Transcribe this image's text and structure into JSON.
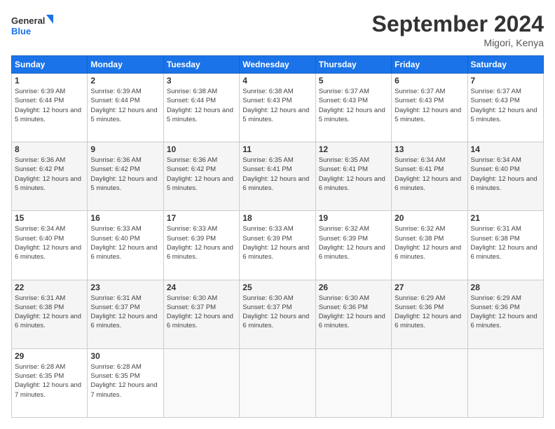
{
  "logo": {
    "line1": "General",
    "line2": "Blue"
  },
  "title": "September 2024",
  "location": "Migori, Kenya",
  "days_header": [
    "Sunday",
    "Monday",
    "Tuesday",
    "Wednesday",
    "Thursday",
    "Friday",
    "Saturday"
  ],
  "weeks": [
    [
      {
        "day": "1",
        "sunrise": "6:39 AM",
        "sunset": "6:44 PM",
        "daylight": "12 hours and 5 minutes."
      },
      {
        "day": "2",
        "sunrise": "6:39 AM",
        "sunset": "6:44 PM",
        "daylight": "12 hours and 5 minutes."
      },
      {
        "day": "3",
        "sunrise": "6:38 AM",
        "sunset": "6:44 PM",
        "daylight": "12 hours and 5 minutes."
      },
      {
        "day": "4",
        "sunrise": "6:38 AM",
        "sunset": "6:43 PM",
        "daylight": "12 hours and 5 minutes."
      },
      {
        "day": "5",
        "sunrise": "6:37 AM",
        "sunset": "6:43 PM",
        "daylight": "12 hours and 5 minutes."
      },
      {
        "day": "6",
        "sunrise": "6:37 AM",
        "sunset": "6:43 PM",
        "daylight": "12 hours and 5 minutes."
      },
      {
        "day": "7",
        "sunrise": "6:37 AM",
        "sunset": "6:43 PM",
        "daylight": "12 hours and 5 minutes."
      }
    ],
    [
      {
        "day": "8",
        "sunrise": "6:36 AM",
        "sunset": "6:42 PM",
        "daylight": "12 hours and 5 minutes."
      },
      {
        "day": "9",
        "sunrise": "6:36 AM",
        "sunset": "6:42 PM",
        "daylight": "12 hours and 5 minutes."
      },
      {
        "day": "10",
        "sunrise": "6:36 AM",
        "sunset": "6:42 PM",
        "daylight": "12 hours and 5 minutes."
      },
      {
        "day": "11",
        "sunrise": "6:35 AM",
        "sunset": "6:41 PM",
        "daylight": "12 hours and 6 minutes."
      },
      {
        "day": "12",
        "sunrise": "6:35 AM",
        "sunset": "6:41 PM",
        "daylight": "12 hours and 6 minutes."
      },
      {
        "day": "13",
        "sunrise": "6:34 AM",
        "sunset": "6:41 PM",
        "daylight": "12 hours and 6 minutes."
      },
      {
        "day": "14",
        "sunrise": "6:34 AM",
        "sunset": "6:40 PM",
        "daylight": "12 hours and 6 minutes."
      }
    ],
    [
      {
        "day": "15",
        "sunrise": "6:34 AM",
        "sunset": "6:40 PM",
        "daylight": "12 hours and 6 minutes."
      },
      {
        "day": "16",
        "sunrise": "6:33 AM",
        "sunset": "6:40 PM",
        "daylight": "12 hours and 6 minutes."
      },
      {
        "day": "17",
        "sunrise": "6:33 AM",
        "sunset": "6:39 PM",
        "daylight": "12 hours and 6 minutes."
      },
      {
        "day": "18",
        "sunrise": "6:33 AM",
        "sunset": "6:39 PM",
        "daylight": "12 hours and 6 minutes."
      },
      {
        "day": "19",
        "sunrise": "6:32 AM",
        "sunset": "6:39 PM",
        "daylight": "12 hours and 6 minutes."
      },
      {
        "day": "20",
        "sunrise": "6:32 AM",
        "sunset": "6:38 PM",
        "daylight": "12 hours and 6 minutes."
      },
      {
        "day": "21",
        "sunrise": "6:31 AM",
        "sunset": "6:38 PM",
        "daylight": "12 hours and 6 minutes."
      }
    ],
    [
      {
        "day": "22",
        "sunrise": "6:31 AM",
        "sunset": "6:38 PM",
        "daylight": "12 hours and 6 minutes."
      },
      {
        "day": "23",
        "sunrise": "6:31 AM",
        "sunset": "6:37 PM",
        "daylight": "12 hours and 6 minutes."
      },
      {
        "day": "24",
        "sunrise": "6:30 AM",
        "sunset": "6:37 PM",
        "daylight": "12 hours and 6 minutes."
      },
      {
        "day": "25",
        "sunrise": "6:30 AM",
        "sunset": "6:37 PM",
        "daylight": "12 hours and 6 minutes."
      },
      {
        "day": "26",
        "sunrise": "6:30 AM",
        "sunset": "6:36 PM",
        "daylight": "12 hours and 6 minutes."
      },
      {
        "day": "27",
        "sunrise": "6:29 AM",
        "sunset": "6:36 PM",
        "daylight": "12 hours and 6 minutes."
      },
      {
        "day": "28",
        "sunrise": "6:29 AM",
        "sunset": "6:36 PM",
        "daylight": "12 hours and 6 minutes."
      }
    ],
    [
      {
        "day": "29",
        "sunrise": "6:28 AM",
        "sunset": "6:35 PM",
        "daylight": "12 hours and 7 minutes."
      },
      {
        "day": "30",
        "sunrise": "6:28 AM",
        "sunset": "6:35 PM",
        "daylight": "12 hours and 7 minutes."
      },
      null,
      null,
      null,
      null,
      null
    ]
  ],
  "labels": {
    "sunrise": "Sunrise:",
    "sunset": "Sunset:",
    "daylight": "Daylight:"
  }
}
